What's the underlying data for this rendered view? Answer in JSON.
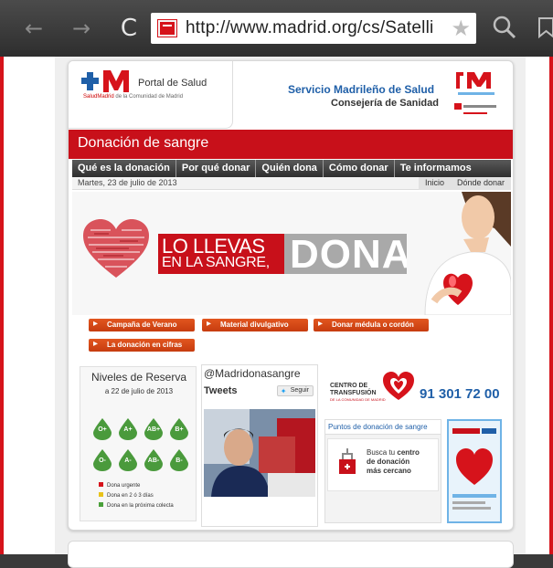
{
  "browser": {
    "back_icon": "←",
    "forward_icon": "→",
    "reload_icon": "C",
    "url": "http://www.madrid.org/cs/Satelli",
    "star_icon": "★"
  },
  "header": {
    "logo_title": "Portal de Salud",
    "logo_brand": "SaludMadrid",
    "logo_tagline": "de la Comunidad de Madrid",
    "service_title": "Servicio Madrileño de Salud",
    "service_subtitle": "Consejería de Sanidad"
  },
  "section": {
    "title": "Donación de sangre"
  },
  "menu": {
    "items": [
      "Qué es la donación",
      "Por qué donar",
      "Quién dona",
      "Cómo donar",
      "Te informamos"
    ]
  },
  "datebar": {
    "date": "Martes, 23 de julio de 2013",
    "links": [
      "Inicio",
      "Dónde donar"
    ]
  },
  "banner": {
    "slogan_line1": "LO LLEVAS",
    "slogan_line2": "EN LA SANGRE,",
    "slogan_dona": "DONA"
  },
  "buttons": [
    "Campaña de Verano",
    "Material divulgativo",
    "Donar médula o cordón",
    "La donación en cifras"
  ],
  "reserva": {
    "title": "Niveles de Reserva",
    "date": "a 22 de julio de 2013",
    "groups": [
      "O+",
      "A+",
      "AB+",
      "B+",
      "O-",
      "A-",
      "AB-",
      "B-"
    ],
    "legend": [
      "Dona urgente",
      "Dona en 2 ó 3 días",
      "Dona en la próxima colecta"
    ],
    "legend_colors": [
      "#d6131b",
      "#e8c21a",
      "#4aa03a"
    ],
    "drop_color": "#4a9a3c"
  },
  "twitter": {
    "handle": "@Madridonasangre",
    "tweets_label": "Tweets",
    "follow_label": "Seguir"
  },
  "transfusion": {
    "title_line1": "CENTRO DE",
    "title_line2": "TRANSFUSIÓN",
    "small": "DE LA COMUNIDAD DE MADRID",
    "phone": "91 301 72 00"
  },
  "puntos": {
    "header": "Puntos de donación de sangre",
    "text_line1": "Busca tu",
    "text_bold1": "centro",
    "text_line2": "de donación",
    "text_line3": "más cercano"
  },
  "colors": {
    "brand_red": "#c8101a",
    "link_blue": "#1f5fa8",
    "button_orange": "#d5491a"
  }
}
